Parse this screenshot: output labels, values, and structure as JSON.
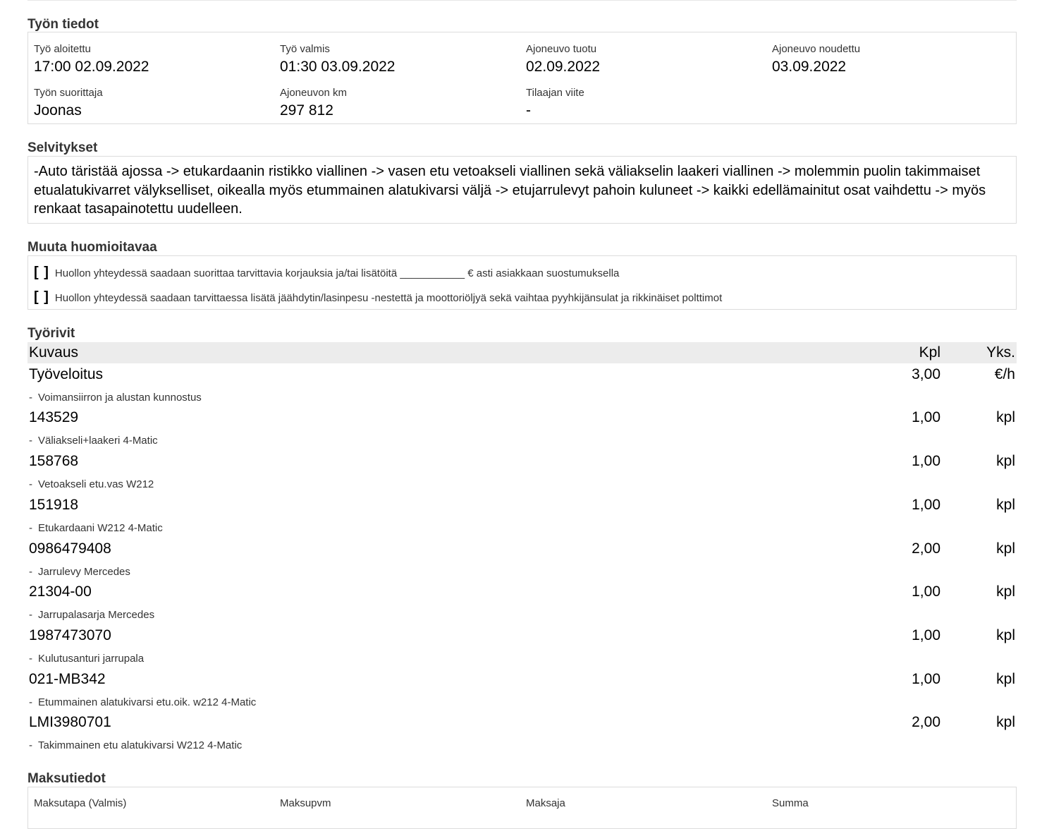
{
  "job_info": {
    "title": "Työn tiedot",
    "fields": [
      {
        "label": "Työ aloitettu",
        "value": "17:00 02.09.2022"
      },
      {
        "label": "Työ valmis",
        "value": "01:30 03.09.2022"
      },
      {
        "label": "Ajoneuvo tuotu",
        "value": "02.09.2022"
      },
      {
        "label": "Ajoneuvo noudettu",
        "value": "03.09.2022"
      },
      {
        "label": "Työn suorittaja",
        "value": "Joonas"
      },
      {
        "label": "Ajoneuvon km",
        "value": "297 812"
      },
      {
        "label": "Tilaajan viite",
        "value": "-"
      }
    ]
  },
  "explanations": {
    "title": "Selvitykset",
    "text": "-Auto täristää ajossa -> etukardaanin ristikko viallinen -> vasen etu vetoakseli viallinen sekä väliakselin laakeri viallinen -> molemmin puolin takimmaiset etualatukivarret välykselliset, oikealla myös etummainen alatukivarsi väljä -> etujarrulevyt pahoin kuluneet -> kaikki edellämainitut osat vaihdettu -> myös renkaat tasapainotettu uudelleen."
  },
  "notes": {
    "title": "Muuta huomioitavaa",
    "checkbox_mark": "[ ]",
    "items": [
      "Huollon yhteydessä saadaan suorittaa tarvittavia korjauksia ja/tai lisätöitä ___________ € asti asiakkaan suostumuksella",
      "Huollon yhteydessä saadaan tarvittaessa lisätä jäähdytin/lasinpesu -nestettä ja moottoriöljyä sekä vaihtaa pyyhkijänsulat ja rikkinäiset polttimot"
    ]
  },
  "work_rows": {
    "title": "Työrivit",
    "headers": {
      "description": "Kuvaus",
      "qty": "Kpl",
      "unit": "Yks."
    },
    "dash": "-",
    "rows": [
      {
        "code": "Työveloitus",
        "qty": "3,00",
        "unit": "€/h",
        "desc": "Voimansiirron ja alustan kunnostus"
      },
      {
        "code": "143529",
        "qty": "1,00",
        "unit": "kpl",
        "desc": "Väliakseli+laakeri 4-Matic"
      },
      {
        "code": "158768",
        "qty": "1,00",
        "unit": "kpl",
        "desc": "Vetoakseli etu.vas W212"
      },
      {
        "code": "151918",
        "qty": "1,00",
        "unit": "kpl",
        "desc": "Etukardaani W212 4-Matic"
      },
      {
        "code": "0986479408",
        "qty": "2,00",
        "unit": "kpl",
        "desc": "Jarrulevy Mercedes"
      },
      {
        "code": "21304-00",
        "qty": "1,00",
        "unit": "kpl",
        "desc": "Jarrupalasarja Mercedes"
      },
      {
        "code": "1987473070",
        "qty": "1,00",
        "unit": "kpl",
        "desc": "Kulutusanturi jarrupala"
      },
      {
        "code": "021-MB342",
        "qty": "1,00",
        "unit": "kpl",
        "desc": "Etummainen alatukivarsi etu.oik. w212 4-Matic"
      },
      {
        "code": "LMI3980701",
        "qty": "2,00",
        "unit": "kpl",
        "desc": "Takimmainen etu alatukivarsi W212 4-Matic"
      }
    ]
  },
  "payment": {
    "title": "Maksutiedot",
    "labels": [
      "Maksutapa (Valmis)",
      "Maksupvm",
      "Maksaja",
      "Summa"
    ]
  }
}
